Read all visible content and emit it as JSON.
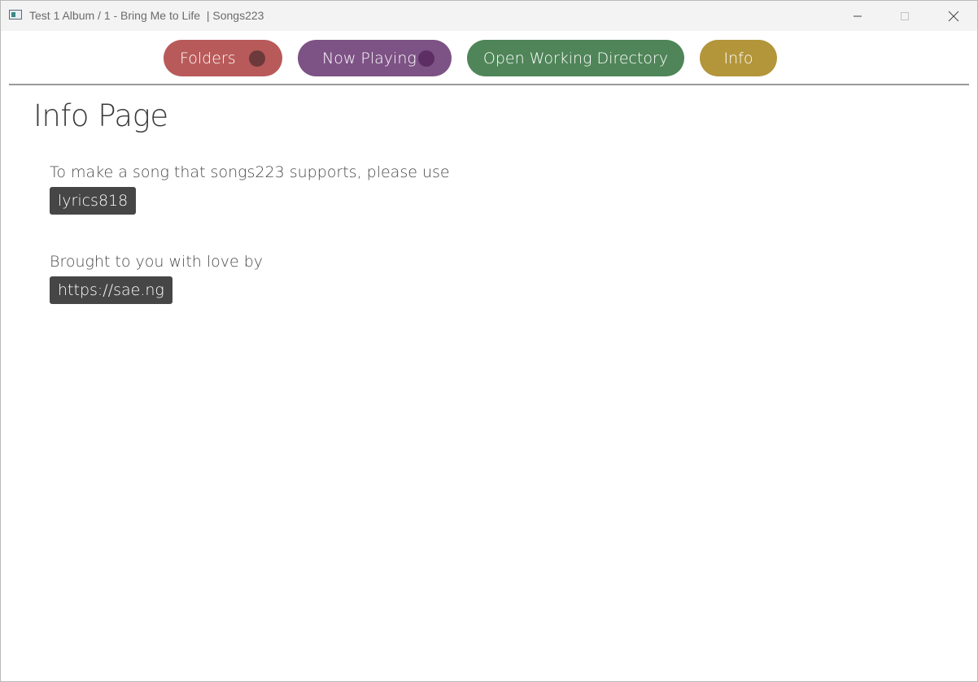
{
  "window": {
    "title": "Test 1 Album / 1 - Bring Me to Life  | Songs223"
  },
  "nav": {
    "folders_label": "Folders",
    "now_playing_label": "Now Playing",
    "open_dir_label": "Open Working Directory",
    "info_label": "Info"
  },
  "colors": {
    "folders": "#b95a5a",
    "now_playing": "#7d5285",
    "open_dir": "#4f8558",
    "info": "#b3953a",
    "chip": "#464646"
  },
  "content": {
    "page_title": "Info Page",
    "line1": "To make a song that songs223 supports, please use",
    "chip1": "lyrics818",
    "line2": "Brought to you with love by",
    "chip2": "https://sae.ng"
  }
}
